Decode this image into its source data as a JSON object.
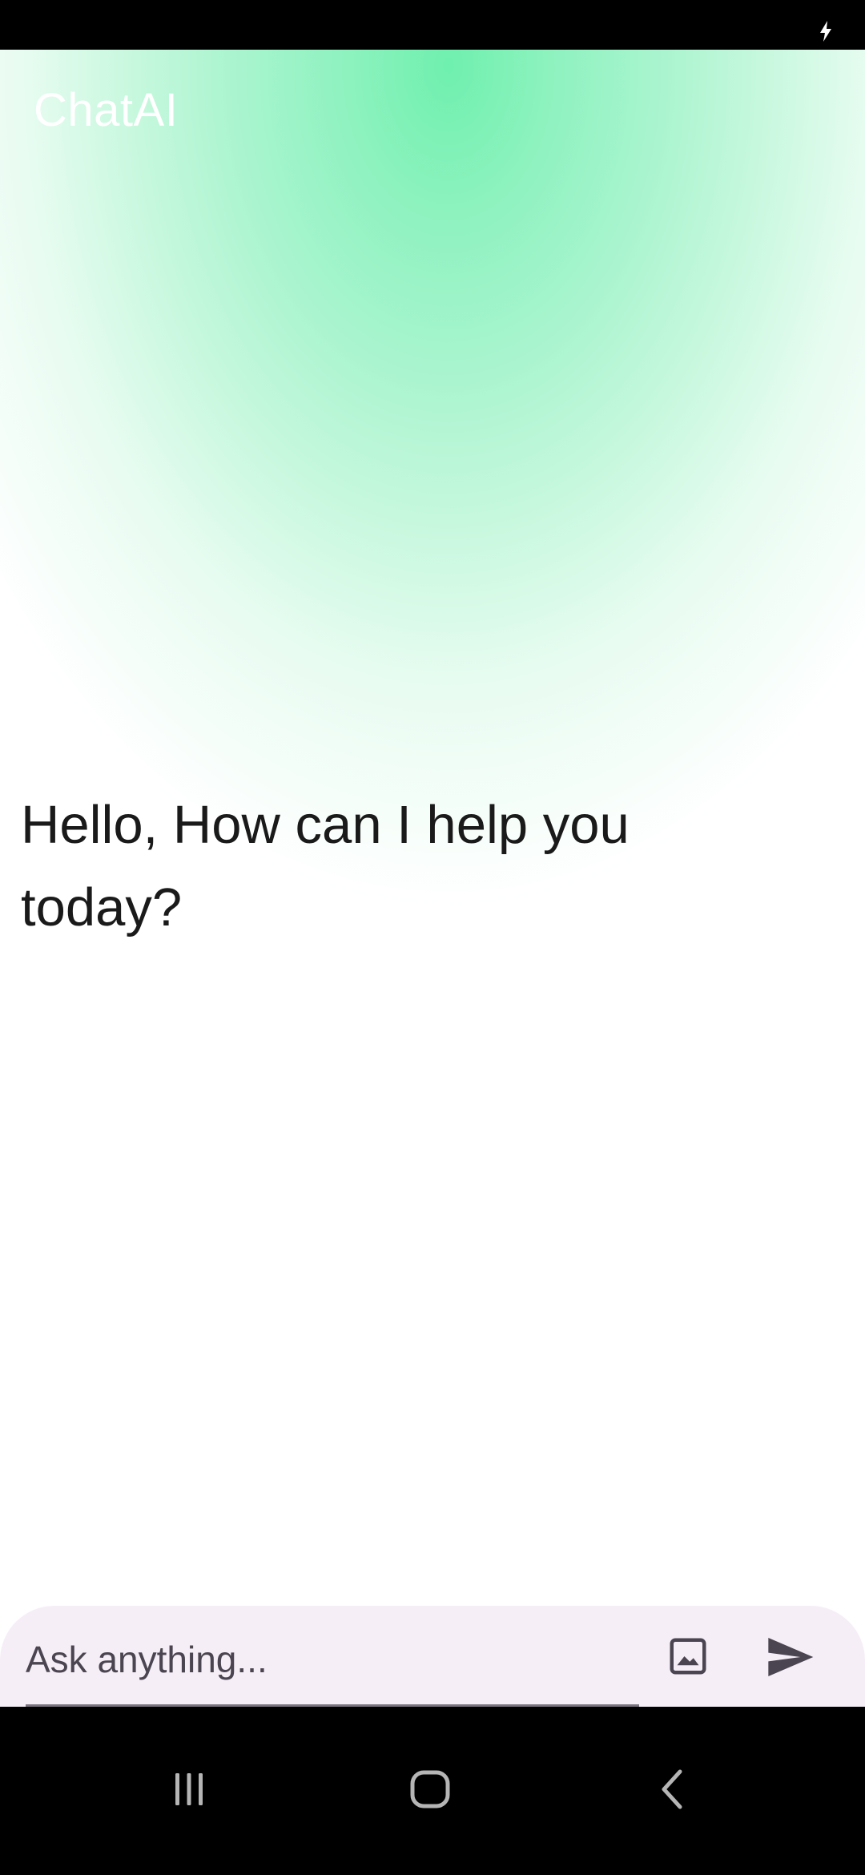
{
  "status_bar": {
    "icons": [
      "charging-icon"
    ]
  },
  "app": {
    "title": "ChatAI"
  },
  "chat": {
    "greeting": "Hello, How can I help you today?"
  },
  "composer": {
    "placeholder": "Ask anything...",
    "value": "",
    "image_button_icon": "image-icon",
    "send_button_icon": "send-icon"
  },
  "nav_bar": {
    "icons": [
      "recent-apps-icon",
      "home-icon",
      "back-icon"
    ]
  },
  "colors": {
    "gradient_primary": "#6ff0ae",
    "status_bar": "#000000",
    "composer_background": "#f6eef7",
    "icon_color": "#4a4550"
  }
}
